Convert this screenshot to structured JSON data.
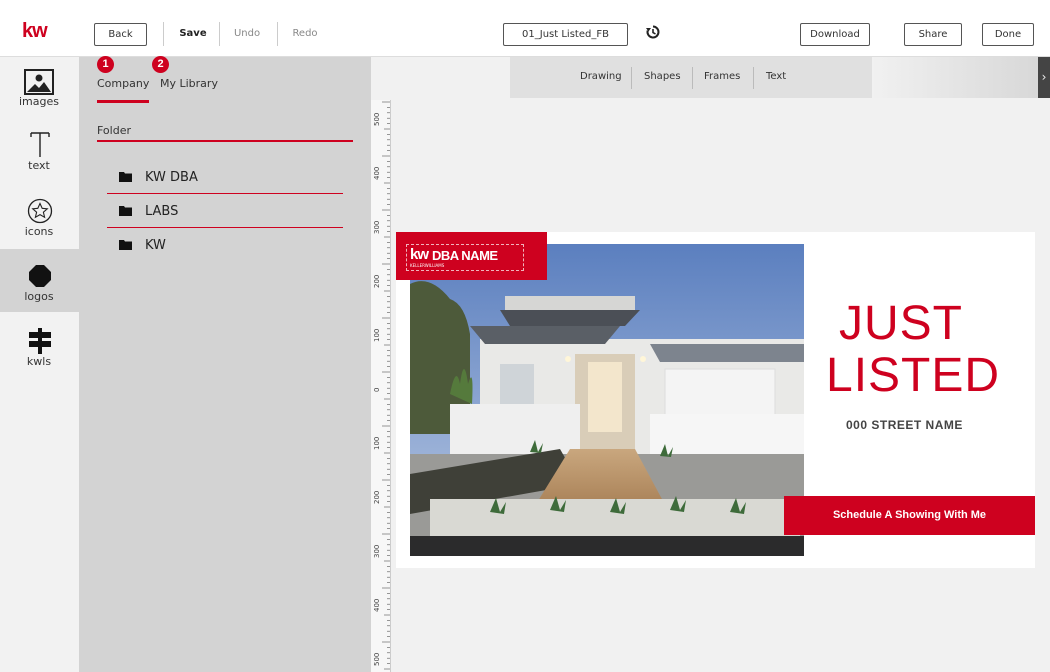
{
  "app": {
    "logo": "kw",
    "brand_color": "#ce011f"
  },
  "toolbar": {
    "back": "Back",
    "save": "Save",
    "undo": "Undo",
    "redo": "Redo",
    "filename": "01_Just Listed_FB",
    "history_icon": "history-icon",
    "download": "Download",
    "share": "Share",
    "done": "Done"
  },
  "rail": {
    "items": [
      {
        "label": "images",
        "icon": "image-icon",
        "active": false
      },
      {
        "label": "text",
        "icon": "text-icon",
        "active": false
      },
      {
        "label": "icons",
        "icon": "star-icon",
        "active": false
      },
      {
        "label": "logos",
        "icon": "octagon-icon",
        "active": true
      },
      {
        "label": "kwls",
        "icon": "signpost-icon",
        "active": false
      }
    ]
  },
  "panel": {
    "tabs": [
      {
        "label": "Company",
        "badge": "1",
        "active": true
      },
      {
        "label": "My Library",
        "badge": "2",
        "active": false
      }
    ],
    "folder_header": "Folder",
    "folders": [
      "KW DBA",
      "LABS",
      "KW"
    ]
  },
  "canvas": {
    "tools": [
      "Drawing",
      "Shapes",
      "Frames",
      "Text"
    ],
    "ruler_labels": [
      "500",
      "400",
      "300",
      "200",
      "100",
      "0",
      "100",
      "200",
      "300",
      "400",
      "500"
    ],
    "flyer": {
      "logo_kw": "kw",
      "logo_name": "DBA NAME",
      "logo_sub": "KELLERWILLIAMS",
      "headline_1": "JUST",
      "headline_2": "LISTED",
      "street": "000 STREET NAME",
      "cta": "Schedule A Showing With Me"
    }
  }
}
